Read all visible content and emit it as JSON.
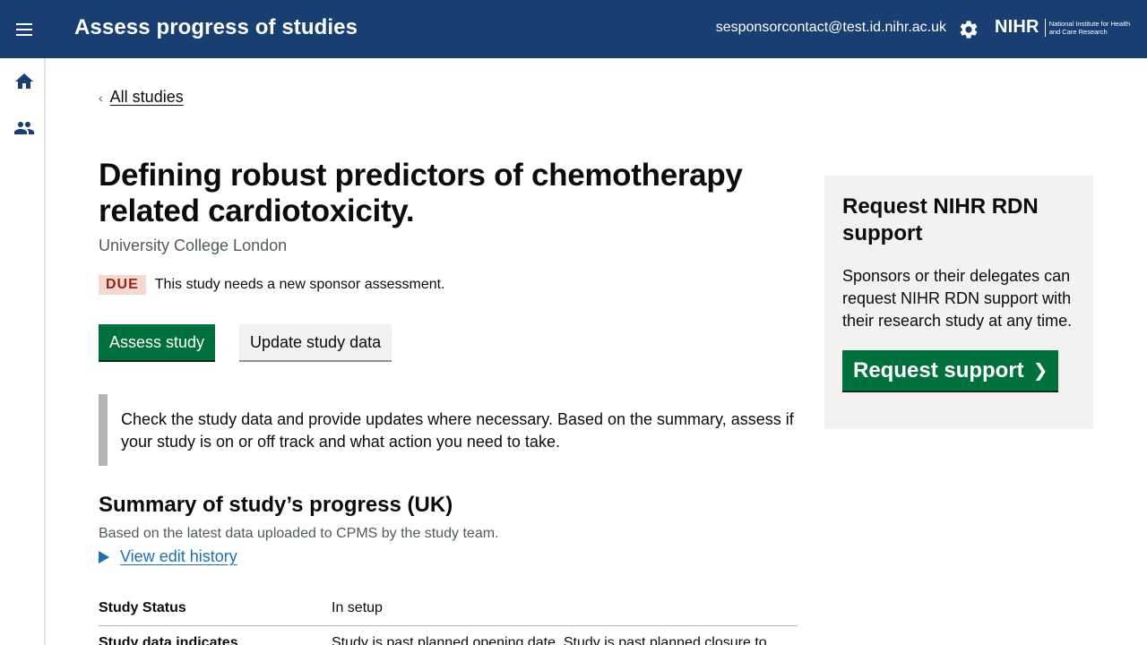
{
  "header": {
    "title": "Assess progress of studies",
    "user_email": "sesponsorcontact@test.id.nihr.ac.uk",
    "logo_main": "NIHR",
    "logo_sub": "National Institute for Health and Care Research",
    "menu_icon": "menu-icon",
    "settings_icon": "gear-icon"
  },
  "sidenav": {
    "items": [
      {
        "icon": "home-icon"
      },
      {
        "icon": "users-icon"
      }
    ]
  },
  "breadcrumb": {
    "back_label": "All studies",
    "chevron": "‹"
  },
  "study": {
    "title": "Defining robust predictors of chemotherapy related cardiotoxicity.",
    "organisation": "University College London",
    "status_tag": "DUE",
    "status_message": "This study needs a new sponsor assessment."
  },
  "actions": {
    "assess_label": "Assess study",
    "update_label": "Update study data"
  },
  "inset_text": "Check the study data and provide updates where necessary. Based on the summary, assess if your study is on or off track and what action you need to take.",
  "summary": {
    "heading": "Summary of study’s progress (UK)",
    "subheading": "Based on the latest data uploaded to CPMS by the study team.",
    "history_link": "View edit history",
    "rows": [
      {
        "key": "Study Status",
        "value": "In setup"
      },
      {
        "key": "Study data indicates",
        "value": "Study is past planned opening date. Study is past planned closure to"
      }
    ]
  },
  "panel": {
    "title": "Request NIHR RDN support",
    "text": "Sponsors or their delegates can request NIHR RDN support with their research study at any time.",
    "button_label": "Request support",
    "button_chevron": "❯"
  },
  "colors": {
    "header_bg": "#193e72",
    "primary_green": "#00703c",
    "link_blue": "#1d70b8",
    "due_bg": "#f6d7d2",
    "due_text": "#942514",
    "panel_bg": "#f3f2f1"
  }
}
